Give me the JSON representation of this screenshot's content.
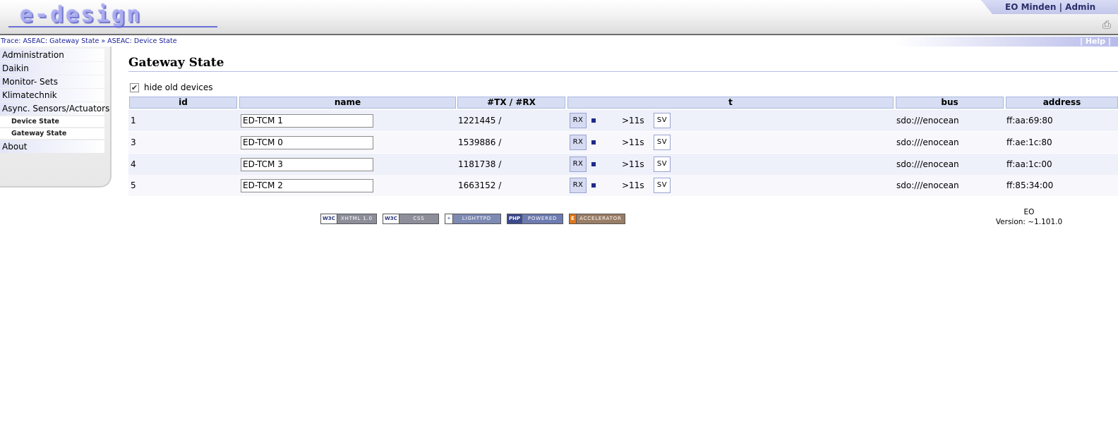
{
  "header": {
    "logo_text": "e-design",
    "user_text": "EO Minden | Admin",
    "print_icon": "printer-icon"
  },
  "trace": {
    "prefix": "Trace:",
    "items": [
      "ASEAC: Gateway State",
      "ASEAC: Device State"
    ],
    "separator": "»",
    "help_label": "| Help |"
  },
  "sidebar": {
    "items": [
      {
        "label": "Administration"
      },
      {
        "label": "Daikin"
      },
      {
        "label": "Monitor- Sets"
      },
      {
        "label": "Klimatechnik"
      },
      {
        "label": "Async. Sensors/Actuators"
      },
      {
        "label": "Device State"
      },
      {
        "label": "Gateway State"
      },
      {
        "label": "About"
      }
    ]
  },
  "main": {
    "title": "Gateway State",
    "hide_old_label": "hide old devices",
    "hide_old_checked": true
  },
  "table": {
    "headers": [
      "id",
      "name",
      "#TX / #RX",
      "t",
      "bus",
      "address"
    ],
    "rx_label": "RX",
    "sv_label": "SV",
    "rows": [
      {
        "id": "1",
        "name": "ED-TCM 1",
        "txrx": "1221445 /",
        "age": ">11s",
        "bus": "sdo:///enocean",
        "address": "ff:aa:69:80"
      },
      {
        "id": "3",
        "name": "ED-TCM 0",
        "txrx": "1539886 /",
        "age": ">11s",
        "bus": "sdo:///enocean",
        "address": "ff:ae:1c:80"
      },
      {
        "id": "4",
        "name": "ED-TCM 3",
        "txrx": "1181738 /",
        "age": ">11s",
        "bus": "sdo:///enocean",
        "address": "ff:aa:1c:00"
      },
      {
        "id": "5",
        "name": "ED-TCM 2",
        "txrx": "1663152 /",
        "age": ">11s",
        "bus": "sdo:///enocean",
        "address": "ff:85:34:00"
      }
    ]
  },
  "footer": {
    "badges": [
      {
        "left": "W3C",
        "right": "XHTML 1.0",
        "color": "#8c8f9a"
      },
      {
        "left": "W3C",
        "right": "CSS",
        "color": "#8c8f9a"
      },
      {
        "left": "",
        "right": "LIGHTTPD",
        "color": "#7d8ab3"
      },
      {
        "left": "PHP",
        "right": "POWERED",
        "color": "#6d7bb0"
      },
      {
        "left": "E",
        "right": "ACCELERATOR",
        "color": "#9a7d66"
      }
    ],
    "org": "EO",
    "version": "Version: ~1.101.0"
  },
  "colors": {
    "accent": "#1a1f99",
    "header_bg": "#d7def3",
    "row_odd": "#eef0fa",
    "row_even": "#f7f7fc"
  }
}
